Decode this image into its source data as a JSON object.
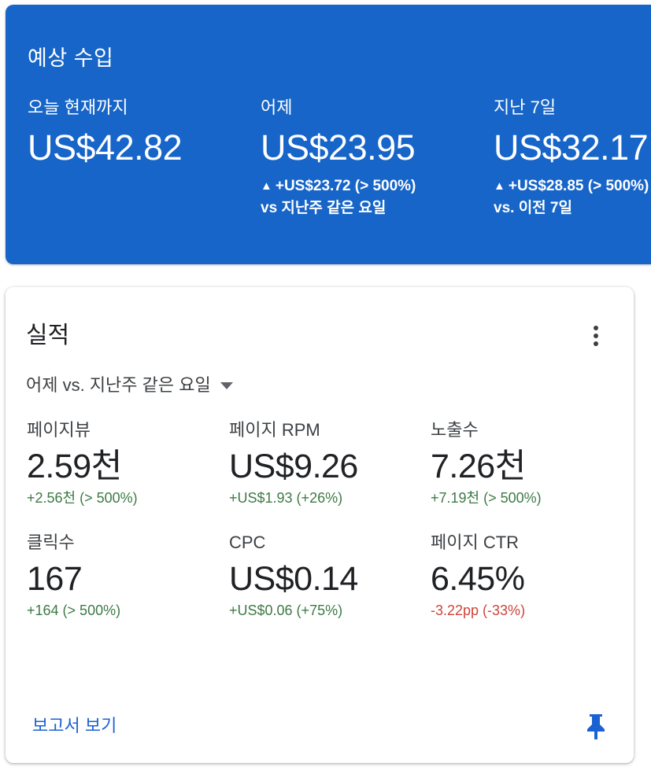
{
  "earnings": {
    "title": "예상 수입",
    "columns": [
      {
        "label": "오늘 현재까지",
        "value": "US$42.82"
      },
      {
        "label": "어제",
        "value": "US$23.95",
        "change_arrow": "▲",
        "change": "+US$23.72 (> 500%)",
        "compare": "vs 지난주 같은 요일"
      },
      {
        "label": "지난 7일",
        "value": "US$32.17",
        "change_arrow": "▲",
        "change": "+US$28.85 (> 500%)",
        "compare": "vs. 이전 7일"
      }
    ],
    "colors": {
      "background": "#1765c8",
      "text": "#ffffff"
    }
  },
  "performance": {
    "title": "실적",
    "more_icon": "more-vert-icon",
    "dropdown": {
      "selected": "어제 vs. 지난주 같은 요일",
      "icon": "caret-down-icon"
    },
    "metrics": [
      {
        "label": "페이지뷰",
        "value": "2.59천",
        "change": "+2.56천 (> 500%)",
        "trend": "positive"
      },
      {
        "label": "페이지 RPM",
        "value": "US$9.26",
        "change": "+US$1.93 (+26%)",
        "trend": "positive"
      },
      {
        "label": "노출수",
        "value": "7.26천",
        "change": "+7.19천 (> 500%)",
        "trend": "positive"
      },
      {
        "label": "클릭수",
        "value": "167",
        "change": "+164 (> 500%)",
        "trend": "positive"
      },
      {
        "label": "CPC",
        "value": "US$0.14",
        "change": "+US$0.06 (+75%)",
        "trend": "positive"
      },
      {
        "label": "페이지 CTR",
        "value": "6.45%",
        "change": "-3.22pp (-33%)",
        "trend": "negative"
      }
    ],
    "report_link": "보고서 보기",
    "pin_icon": "pin-icon",
    "colors": {
      "positive": "#3d7a45",
      "negative": "#d0443b",
      "link": "#1a62d4"
    }
  }
}
